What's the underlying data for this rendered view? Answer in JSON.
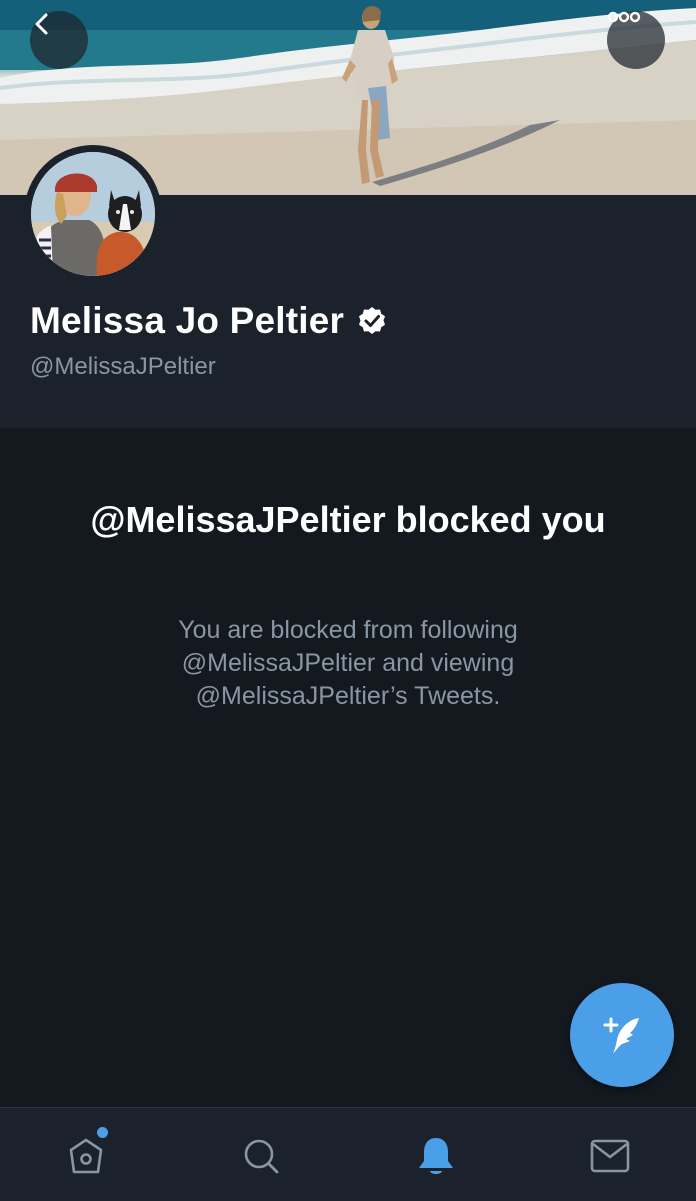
{
  "profile": {
    "display_name": "Melissa Jo Peltier",
    "handle": "@MelissaJPeltier",
    "verified": true
  },
  "blocked": {
    "title": "@MelissaJPeltier blocked you",
    "description": "You are blocked from following @MelissaJPeltier and viewing @MelissaJPeltier’s Tweets."
  },
  "icons": {
    "back": "chevron-left-icon",
    "more": "more-horizontal-icon",
    "verified": "verified-badge-icon",
    "compose": "compose-tweet-icon",
    "home": "home-icon",
    "search": "search-icon",
    "notifications": "bell-icon",
    "messages": "mail-icon"
  },
  "colors": {
    "background": "#141920",
    "header_background": "#1b222c",
    "accent": "#4a9fe8",
    "secondary_text": "#8a96a3",
    "primary_text": "#ffffff"
  },
  "nav": {
    "active_tab": "notifications",
    "home_has_unread": true
  }
}
